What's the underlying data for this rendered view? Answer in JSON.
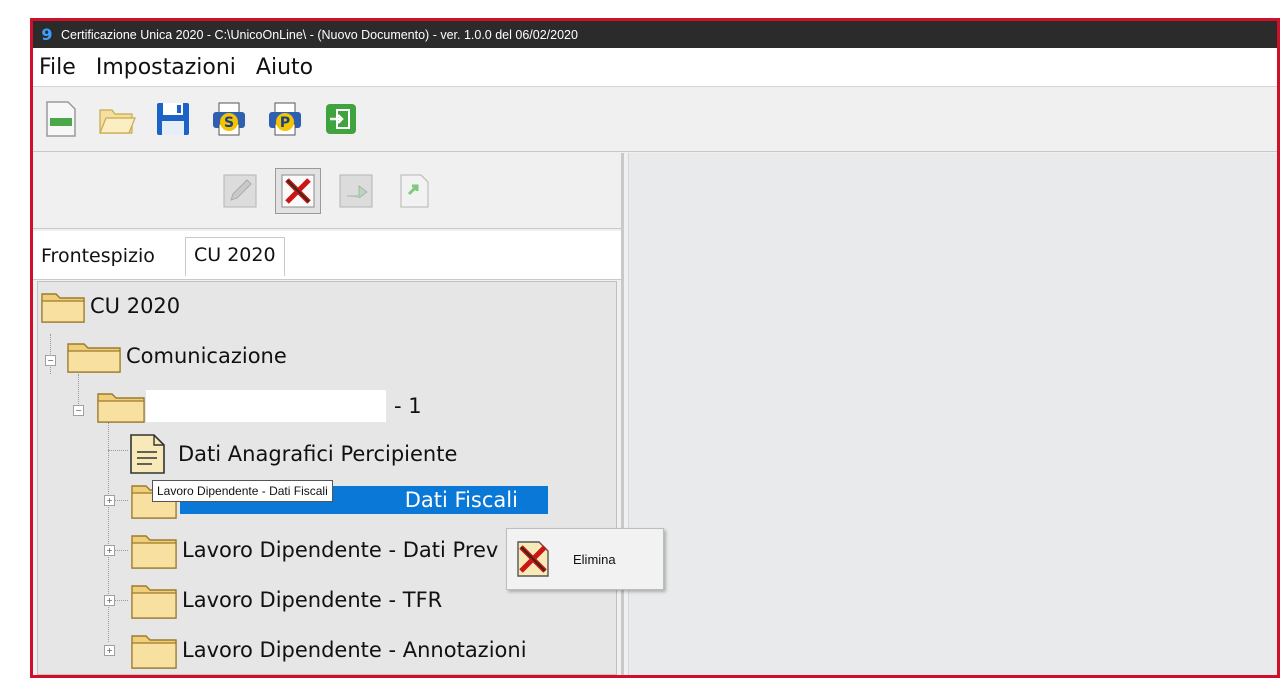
{
  "window": {
    "title": "Certificazione Unica 2020 - C:\\UnicoOnLine\\ - (Nuovo Documento)  -  ver. 1.0.0 del 06/02/2020"
  },
  "menu": {
    "items": [
      "File",
      "Impostazioni",
      "Aiuto"
    ]
  },
  "toolbar": {
    "icons": [
      "new-document-icon",
      "open-folder-icon",
      "save-icon",
      "print-s-icon",
      "print-p-icon",
      "exit-icon"
    ]
  },
  "subtoolbar": {
    "icons": [
      "edit-icon",
      "delete-icon",
      "import-icon",
      "export-icon"
    ]
  },
  "tabs": {
    "inactive": "Frontespizio",
    "active": "CU 2020"
  },
  "tree": {
    "root": "CU 2020",
    "communication": "Comunicazione",
    "record_suffix": "- 1",
    "items": [
      "Dati Anagrafici Percipiente",
      "Dati Fiscali",
      "Lavoro Dipendente - Dati Prev",
      "Lavoro Dipendente - TFR",
      "Lavoro Dipendente - Annotazioni"
    ]
  },
  "tooltip": {
    "text": "Lavoro Dipendente - Dati Fiscali"
  },
  "context_menu": {
    "delete_label": "Elimina"
  },
  "colors": {
    "selection": "#0a78d7",
    "frame_border": "#d0102a",
    "titlebar": "#2b2b2b"
  }
}
